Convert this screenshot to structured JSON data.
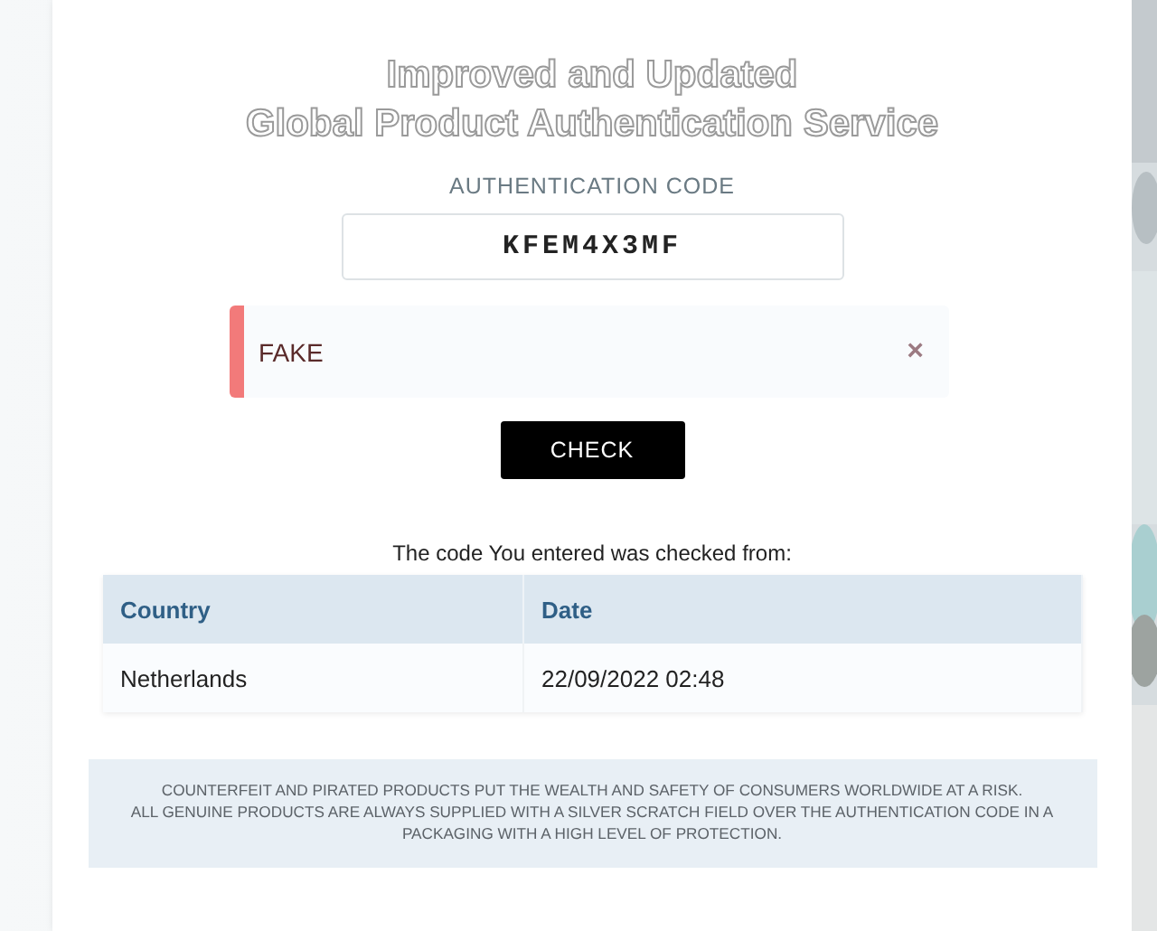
{
  "title_lines": [
    "Improved and Updated",
    "Global Product Authentication Service"
  ],
  "code_field": {
    "label": "AUTHENTICATION CODE",
    "value": "KFEM4X3MF"
  },
  "alert": {
    "text": "FAKE",
    "close": "×"
  },
  "check_button": "CHECK",
  "history": {
    "caption": "The code You entered was checked from:",
    "columns": [
      "Country",
      "Date"
    ],
    "rows": [
      [
        "Netherlands",
        "22/09/2022 02:48"
      ]
    ]
  },
  "notice": [
    "COUNTERFEIT AND PIRATED PRODUCTS PUT THE WEALTH AND SAFETY OF CONSUMERS WORLDWIDE AT A RISK.",
    "ALL GENUINE PRODUCTS ARE ALWAYS SUPPLIED WITH A SILVER SCRATCH FIELD OVER THE AUTHENTICATION CODE IN A PACKAGING WITH A HIGH LEVEL OF PROTECTION."
  ]
}
